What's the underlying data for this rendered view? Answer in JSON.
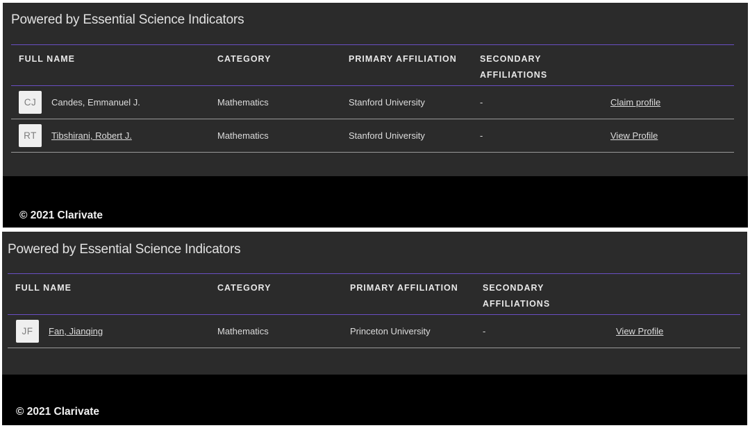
{
  "panels": [
    {
      "powered_by": "Powered by Essential Science Indicators",
      "headers": {
        "full_name": "FULL NAME",
        "category": "CATEGORY",
        "primary": "PRIMARY AFFILIATION",
        "secondary": "SECONDARY AFFILIATIONS"
      },
      "rows": [
        {
          "initials": "CJ",
          "name": "Candes, Emmanuel J.",
          "category": "Mathematics",
          "primary": "Stanford University",
          "secondary": "-",
          "action": "Claim profile"
        },
        {
          "initials": "RT",
          "name": "Tibshirani, Robert J.",
          "category": "Mathematics",
          "primary": "Stanford University",
          "secondary": "-",
          "action": "View Profile"
        }
      ],
      "footer": "© 2021 Clarivate"
    },
    {
      "powered_by": "Powered by Essential Science Indicators",
      "headers": {
        "full_name": "FULL NAME",
        "category": "CATEGORY",
        "primary": "PRIMARY AFFILIATION",
        "secondary": "SECONDARY AFFILIATIONS"
      },
      "rows": [
        {
          "initials": "JF",
          "name": "Fan, Jianqing",
          "category": "Mathematics",
          "primary": "Princeton University",
          "secondary": "-",
          "action": "View Profile"
        }
      ],
      "footer": "© 2021 Clarivate"
    }
  ],
  "colors": {
    "panel_bg": "#2b2b2b",
    "footer_bg": "#000000",
    "accent_border": "#6a4fc4"
  }
}
